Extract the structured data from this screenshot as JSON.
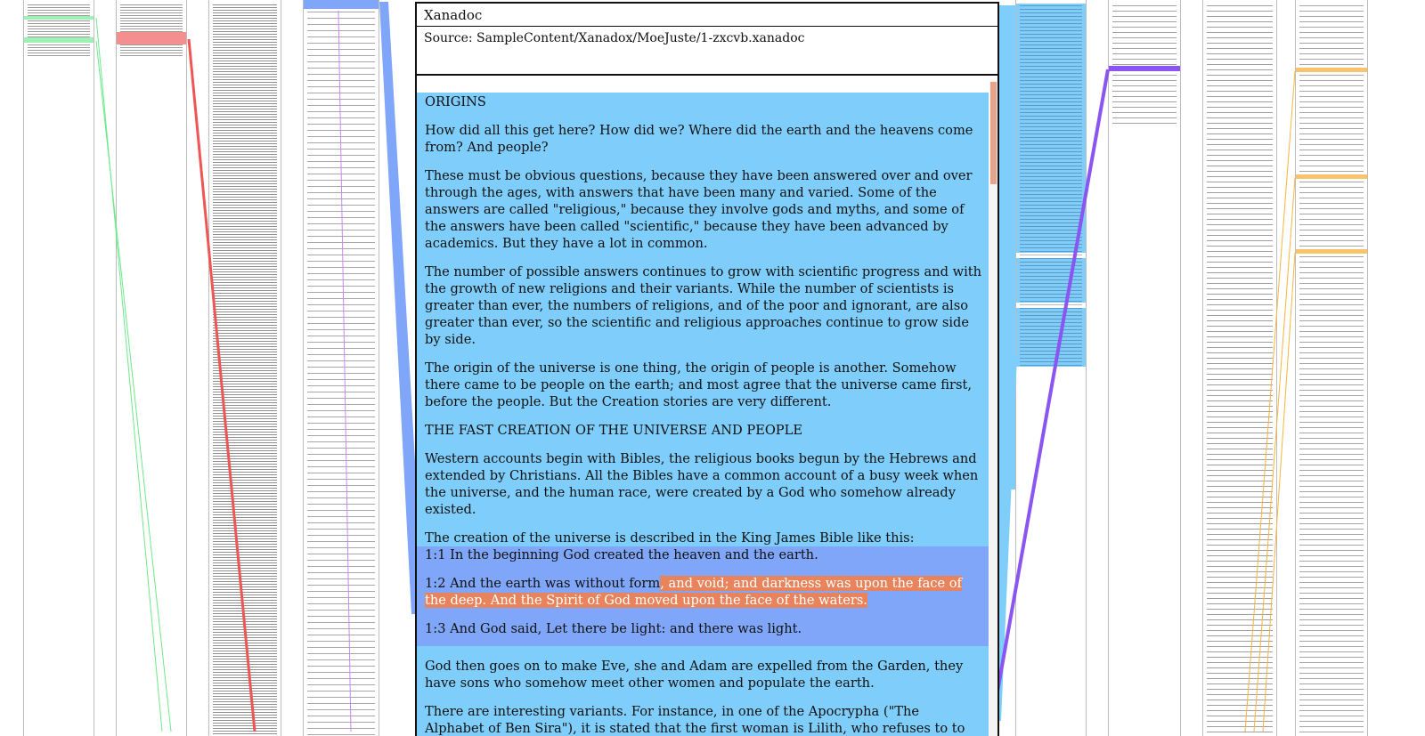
{
  "app": {
    "title": "Xanadoc",
    "source_label": "Source: SampleContent/Xanadox/MoeJuste/1-zxcvb.xanadoc"
  },
  "colors": {
    "transclusion_blue": "#7ecdfb",
    "quote_blue": "#7fa6f9",
    "orange_highlight": "#e8835c",
    "purple_link": "#8a55f0",
    "red_link": "#ee5555",
    "green_link": "#6ee88c",
    "yellow_link": "#f7b540"
  },
  "content": {
    "heading_origins": "ORIGINS",
    "p1": "How did all this get here? How did we? Where did the earth and the heavens come from? And people?",
    "p2": "These must be obvious questions, because they have been answered over and over through the ages, with answers that have been many and varied. Some of the answers are called \"religious,\" because they involve gods and myths, and some of the answers have been called \"scientific,\" because they have been advanced by academics. But they have a lot in common.",
    "p3": "The number of possible answers continues to grow with scientific progress and with the growth of new religions and their variants. While the number of scientists is greater than ever, the numbers of religions, and of the poor and ignorant, are also greater than ever, so the scientific and religious approaches continue to grow side by side.",
    "p4": "The origin of the universe is one thing, the origin of people is another. Somehow there came to be people on the earth; and most agree that the universe came first, before the people. But the Creation stories are very different.",
    "heading_fast": "THE FAST CREATION OF THE UNIVERSE AND PEOPLE",
    "p5": "Western accounts begin with Bibles, the religious books begun by the Hebrews and extended by Christians. All the Bibles have a common account of a busy week when the universe, and the human race, were created by a God who somehow already existed.",
    "p6": "The creation of the universe is described in the King James Bible like this:",
    "verse1": "1:1 In the beginning God created the heaven and the earth.",
    "verse2_a": "1:2 And the earth was without form",
    "verse2_b": ", and void; and darkness was upon the face of the deep. And the Spirit of God moved upon the face of the waters.",
    "verse3": "1:3 And God said, Let there be light: and there was light.",
    "p7": "God then goes on to make Eve, she and Adam are expelled from the Garden, they have sons who somehow meet other women and populate the earth.",
    "p8": "There are interesting variants. For instance, in one of the Apocrypha (\"The Alphabet of Ben Sira\"), it is stated that the first woman is Lilith, who refuses to to accept a sex-on-the-bottom position, and to whom Adam grants equality--"
  }
}
